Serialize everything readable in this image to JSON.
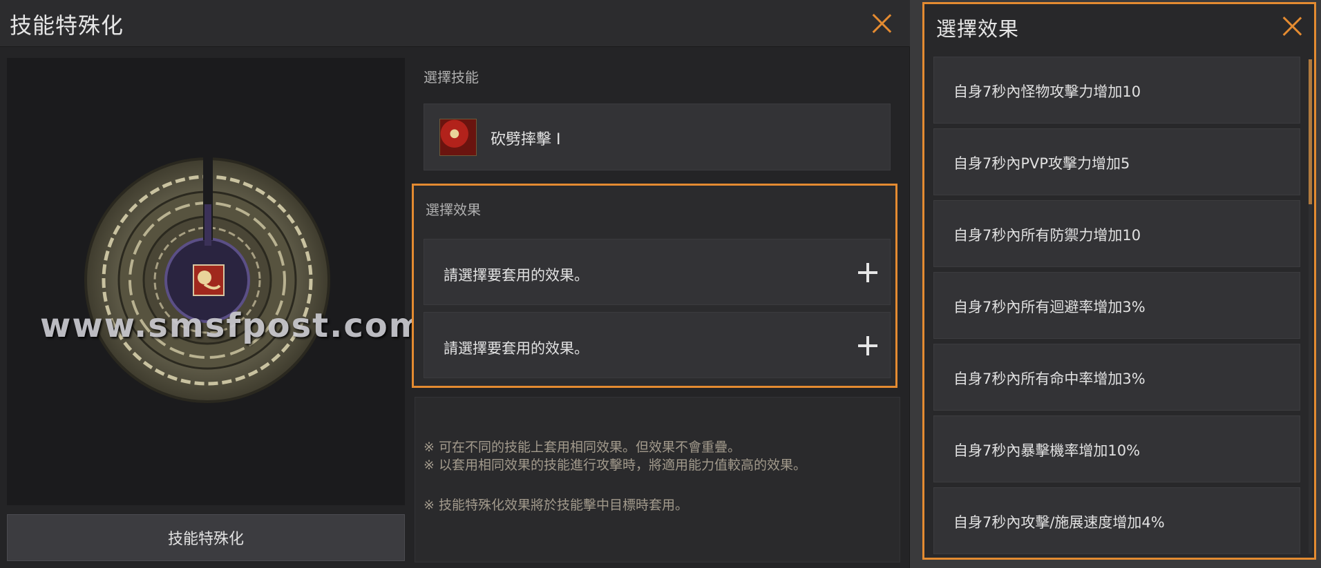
{
  "left_panel": {
    "title": "技能特殊化",
    "watermark": "www.smsfpost.com",
    "specialize_button": "技能特殊化",
    "select_skill_label": "選擇技能",
    "selected_skill": {
      "name": "砍劈摔擊 I",
      "icon": "skill-icon"
    },
    "select_effect_label": "選擇效果",
    "effect_slots": [
      {
        "text": "請選擇要套用的效果。",
        "icon": "plus-icon"
      },
      {
        "text": "請選擇要套用的效果。",
        "icon": "plus-icon"
      }
    ],
    "notes": [
      "※ 可在不同的技能上套用相同效果。但效果不會重疊。",
      "※ 以套用相同效果的技能進行攻擊時，將適用能力值較高的效果。",
      "※ 技能特殊化效果將於技能擊中目標時套用。"
    ]
  },
  "right_panel": {
    "title": "選擇效果",
    "options": [
      "自身7秒內怪物攻擊力增加10",
      "自身7秒內PVP攻擊力增加5",
      "自身7秒內所有防禦力增加10",
      "自身7秒內所有迴避率增加3%",
      "自身7秒內所有命中率增加3%",
      "自身7秒內暴擊機率增加10%",
      "自身7秒內攻擊/施展速度增加4%"
    ]
  },
  "colors": {
    "accent": "#e48b31",
    "panel_bg": "#242426",
    "card_bg": "#333336",
    "note_text": "#a29a8c"
  }
}
